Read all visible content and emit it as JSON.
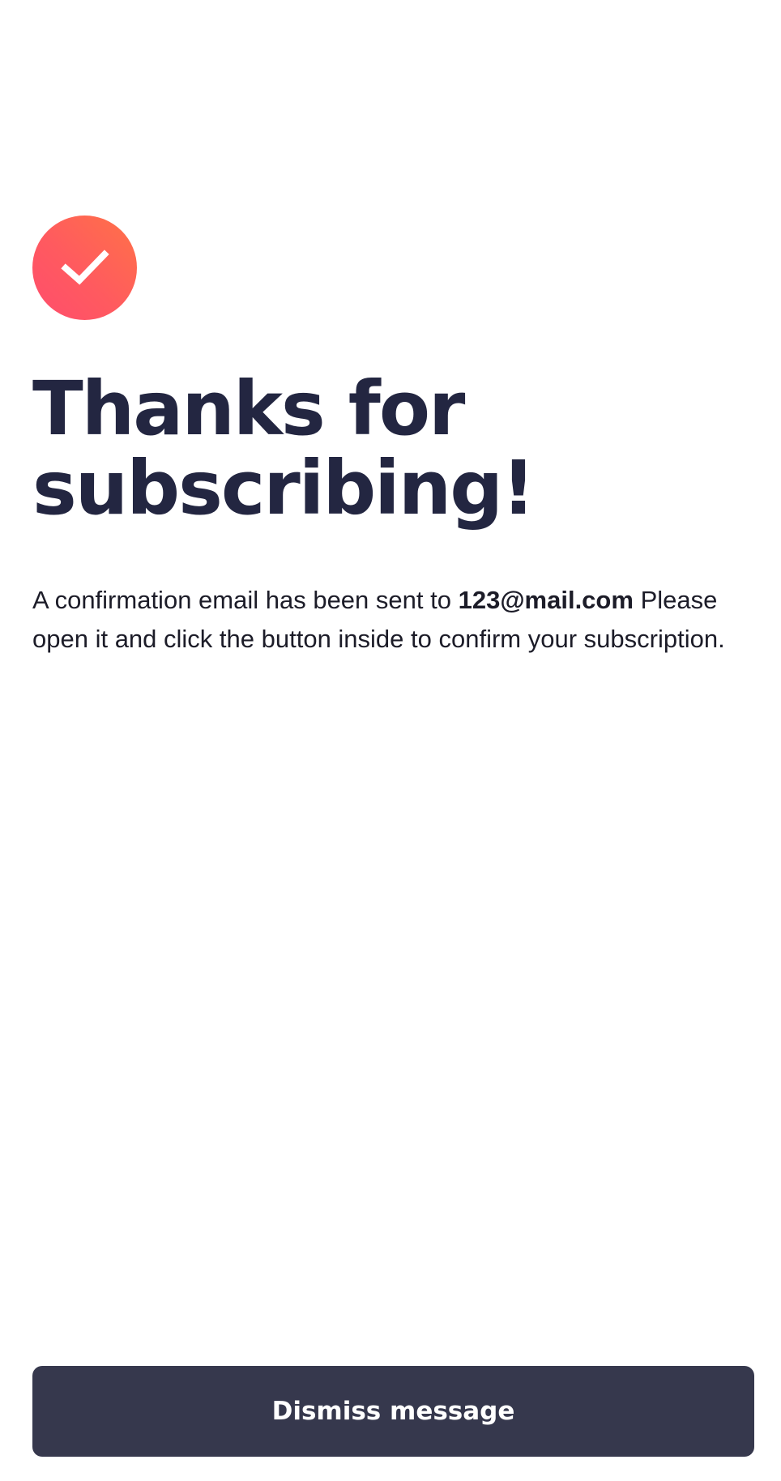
{
  "icon": {
    "name": "checkmark-icon",
    "gradient_start": "#ff7247",
    "gradient_end": "#ff4d6d"
  },
  "title": {
    "line1": "Thanks for",
    "line2": "subscribing!"
  },
  "message": {
    "prefix": "A confirmation email has been sent to",
    "email": "123@mail.com",
    "suffix": "Please open it and click the button inside to confirm your subscription."
  },
  "button": {
    "label": "Dismiss message",
    "color": "#36384d"
  }
}
